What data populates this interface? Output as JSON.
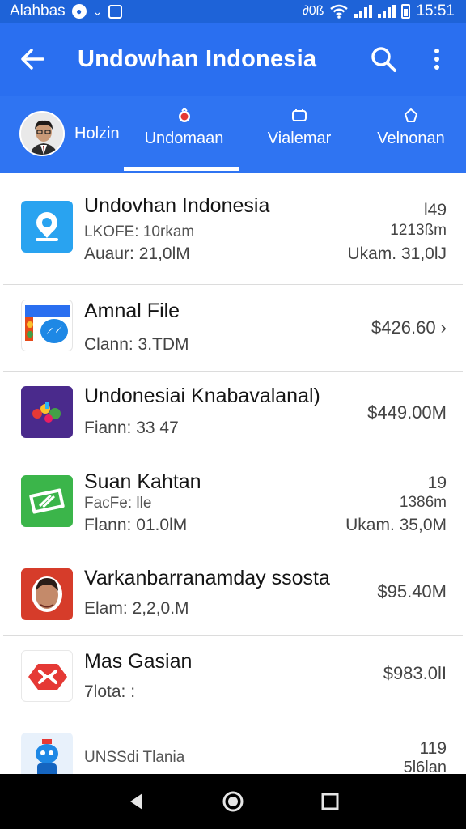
{
  "status_bar": {
    "carrier": "Alahbas",
    "network": "∂0ß",
    "time": "15:51"
  },
  "app_bar": {
    "title": "Undowhan Indonesia"
  },
  "tabs": {
    "profile_label": "Holzin",
    "items": [
      {
        "label": "Undomaan"
      },
      {
        "label": "Vialemar"
      },
      {
        "label": "Velnonan"
      }
    ]
  },
  "apps": [
    {
      "name": "Undovhan Indonesia",
      "sub": "LKOFE: 10rkam",
      "meta": "Auaur: 21,0lM",
      "right_top": "l49",
      "right_mid": "1213ßm",
      "right_bot": "Ukam. 31,0lJ"
    },
    {
      "name": "Amnal File",
      "meta": "Clann:   3.TDM",
      "right_price": "$426.60 ›"
    },
    {
      "name": "Undonesiai Knabavalanal)",
      "meta": "Fiann: 33 47",
      "right_price": "$449.00M"
    },
    {
      "name": "Suan Kahtan",
      "sub": "FacFe: lle",
      "meta": "Flann: 01.0lM",
      "right_top": "19",
      "right_mid": "1386m",
      "right_bot": "Ukam. 35,0M"
    },
    {
      "name": "Varkanbarranamday ssosta",
      "meta": "Elam: 2,2,0.M",
      "right_price": "$95.40M"
    },
    {
      "name": "Mas Gasian",
      "meta": "7lota: :",
      "right_price": "$983.0lI"
    },
    {
      "sub": "UNSSdi Tlania",
      "right_top": "119",
      "right_mid": "5l6lan"
    }
  ],
  "colors": {
    "status_bar": "#1e63d8",
    "app_bar": "#2a6ff0",
    "tabs": "#2f74f2",
    "nav_bar": "#000000"
  }
}
